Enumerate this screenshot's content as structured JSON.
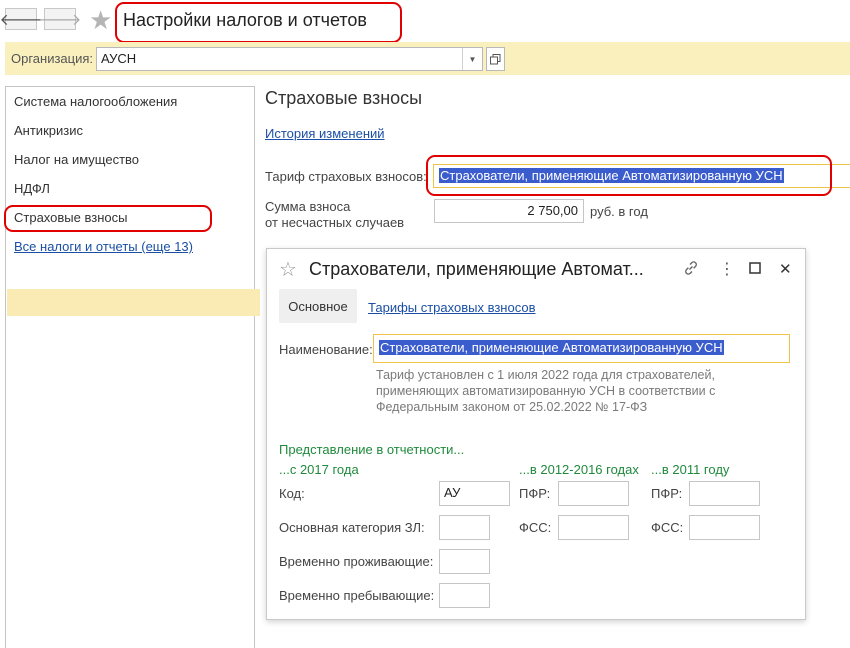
{
  "window": {
    "title": "Настройки налогов и отчетов",
    "back_glyph": "🡐",
    "forward_glyph": "🡒",
    "star_glyph": "★"
  },
  "org": {
    "label": "Организация:",
    "value": "АУСН",
    "dropdown_glyph": "▼"
  },
  "sidebar": {
    "items": [
      {
        "label": "Система налогообложения"
      },
      {
        "label": "Антикризис"
      },
      {
        "label": "Налог на имущество"
      },
      {
        "label": "НДФЛ"
      },
      {
        "label": "Страховые взносы"
      }
    ],
    "selected_index": 4,
    "all_link": "Все налоги и отчеты (еще 13)"
  },
  "main": {
    "heading": "Страховые взносы",
    "history_link": "История изменений",
    "tariff_label": "Тариф страховых взносов:",
    "tariff_value": "Страхователи, применяющие Автоматизированную УСН",
    "accident_label_line1": "Сумма взноса",
    "accident_label_line2": "от несчастных случаев",
    "accident_value": "2 750,00",
    "accident_unit": "руб. в год"
  },
  "dialog": {
    "title": "Страхователи, применяющие Автомат...",
    "star_glyph": "☆",
    "link_glyph": "🔗",
    "more_glyph": "⋮",
    "maximize_glyph": "☐",
    "close_glyph": "✕",
    "tabs": [
      {
        "label": "Основное",
        "active": true
      },
      {
        "label": "Тарифы страховых взносов",
        "active": false
      }
    ],
    "name_label": "Наименование:",
    "name_value": "Страхователи, применяющие Автоматизированную УСН",
    "note_line1": "Тариф установлен с 1 июля 2022 года для страхователей,",
    "note_line2": "применяющих автоматизированную УСН в соответствии с",
    "note_line3": "Федеральным законом от 25.02.2022 № 17-ФЗ",
    "reporting_heading": "Представление в отчетности...",
    "col_2017": "...с 2017 года",
    "col_2012_2016": "...в 2012-2016 годах",
    "col_2011": "...в 2011 году",
    "code_label": "Код:",
    "code_value": "АУ",
    "pfr_label": "ПФР:",
    "category_label": "Основная категория ЗЛ:",
    "fss_label": "ФСС:",
    "temp_living_label": "Временно проживающие:",
    "temp_staying_label": "Временно пребывающие:"
  },
  "colors": {
    "accent_yellow": "#faf0bd",
    "selection_blue": "#3a5ccd",
    "link_blue": "#1a4fa5",
    "annotation_red": "#e00000",
    "focus_orange": "#f0c44a",
    "section_green": "#1f8a3c"
  }
}
